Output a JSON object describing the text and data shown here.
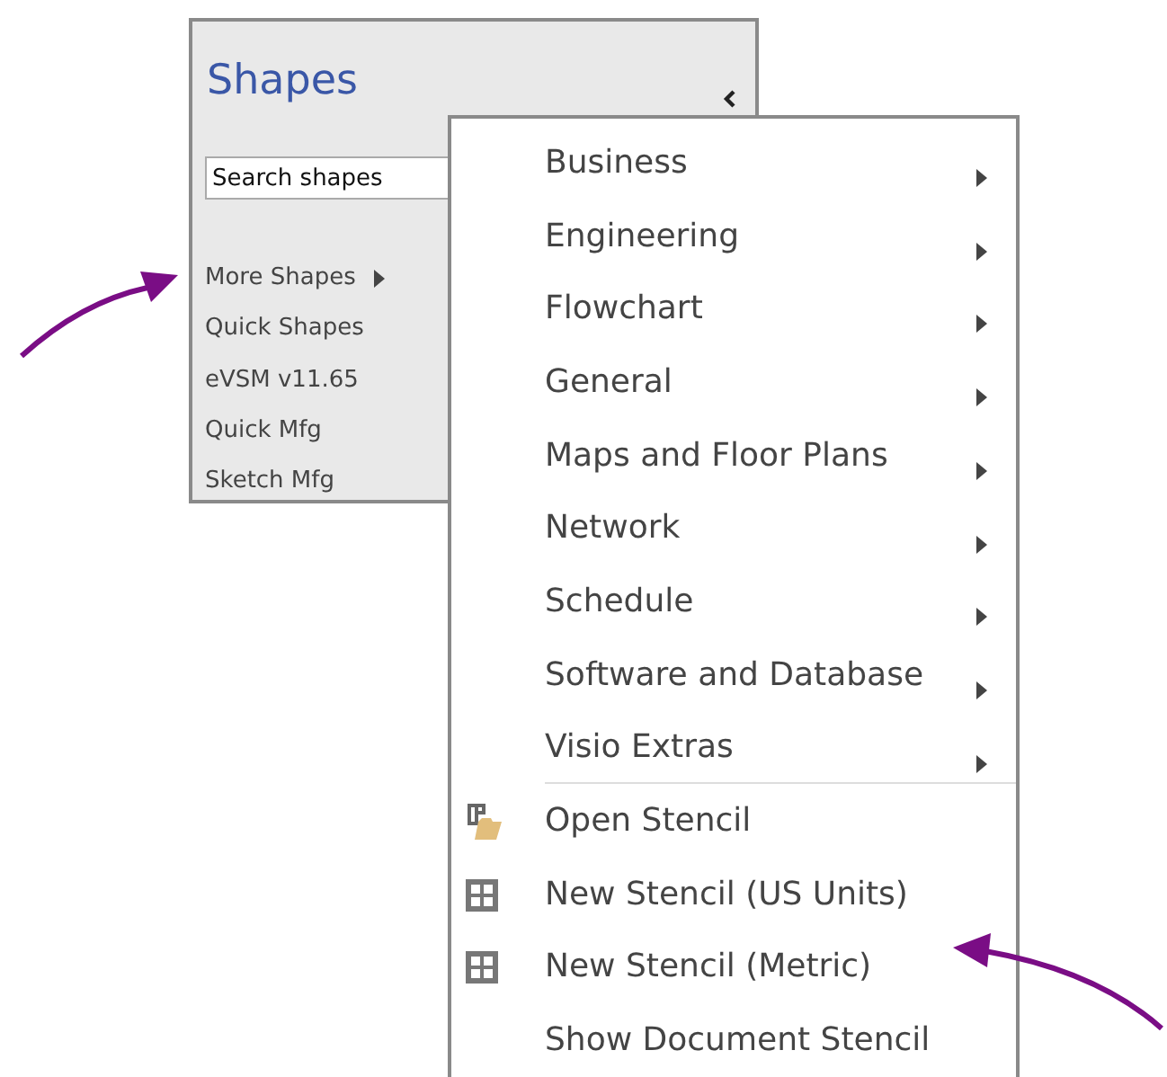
{
  "shapes_panel": {
    "title": "Shapes",
    "search": {
      "placeholder": "Search shapes"
    },
    "stencils": [
      {
        "label": "More Shapes",
        "kind": "submenu"
      },
      {
        "label": "Quick Shapes",
        "kind": "plain"
      },
      {
        "label": "eVSM v11.65",
        "kind": "plain"
      },
      {
        "label": "Quick Mfg",
        "kind": "plain"
      },
      {
        "label": "Sketch Mfg",
        "kind": "plain"
      }
    ]
  },
  "menu": {
    "items": [
      {
        "label": "Business",
        "kind": "submenu"
      },
      {
        "label": "Engineering",
        "kind": "submenu"
      },
      {
        "label": "Flowchart",
        "kind": "submenu"
      },
      {
        "label": "General",
        "kind": "submenu"
      },
      {
        "label": "Maps and Floor Plans",
        "kind": "submenu"
      },
      {
        "label": "Network",
        "kind": "submenu"
      },
      {
        "label": "Schedule",
        "kind": "submenu"
      },
      {
        "label": "Software and Database",
        "kind": "submenu"
      },
      {
        "label": "Visio Extras",
        "kind": "submenu"
      },
      {
        "label": "Open Stencil",
        "kind": "open"
      },
      {
        "label": "New Stencil (US Units)",
        "kind": "new"
      },
      {
        "label": "New Stencil (Metric)",
        "kind": "new"
      },
      {
        "label": "Show Document Stencil",
        "kind": "plain"
      }
    ]
  }
}
